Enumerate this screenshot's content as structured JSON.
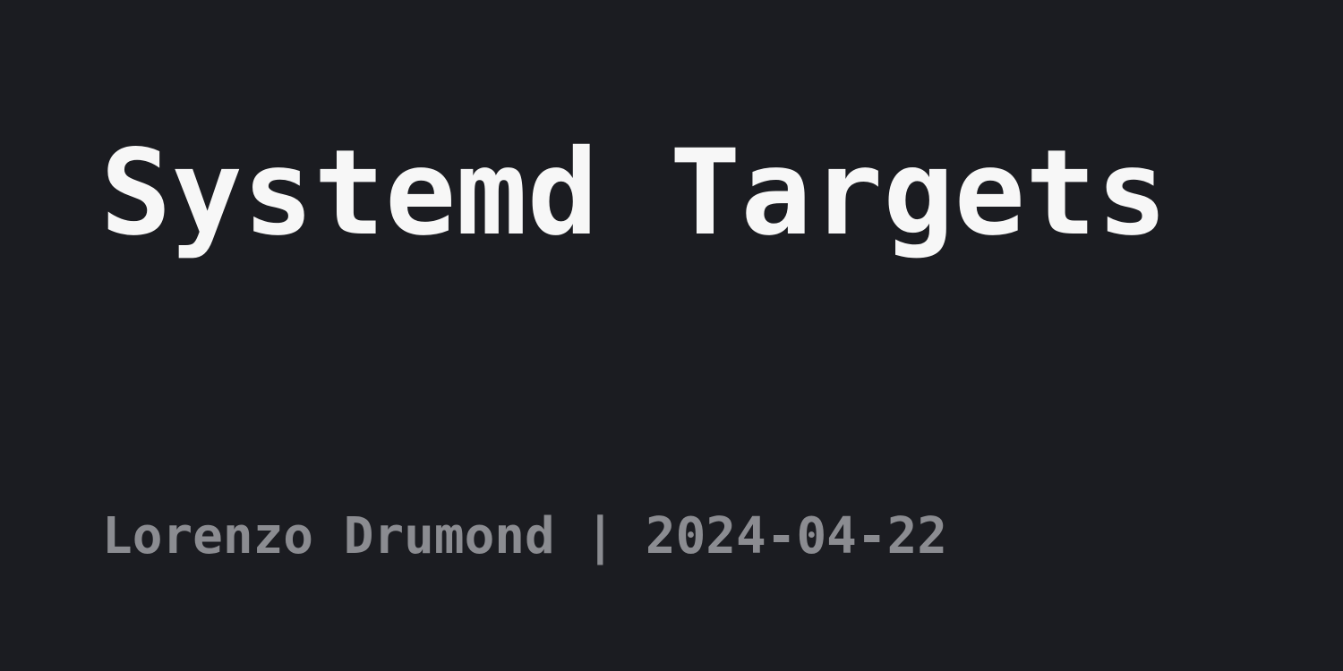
{
  "post": {
    "title": "Systemd Targets",
    "meta": "Lorenzo Drumond | 2024-04-22"
  },
  "colors": {
    "background": "#1b1c21",
    "title": "#f7f7f7",
    "meta": "#8b8c91"
  }
}
